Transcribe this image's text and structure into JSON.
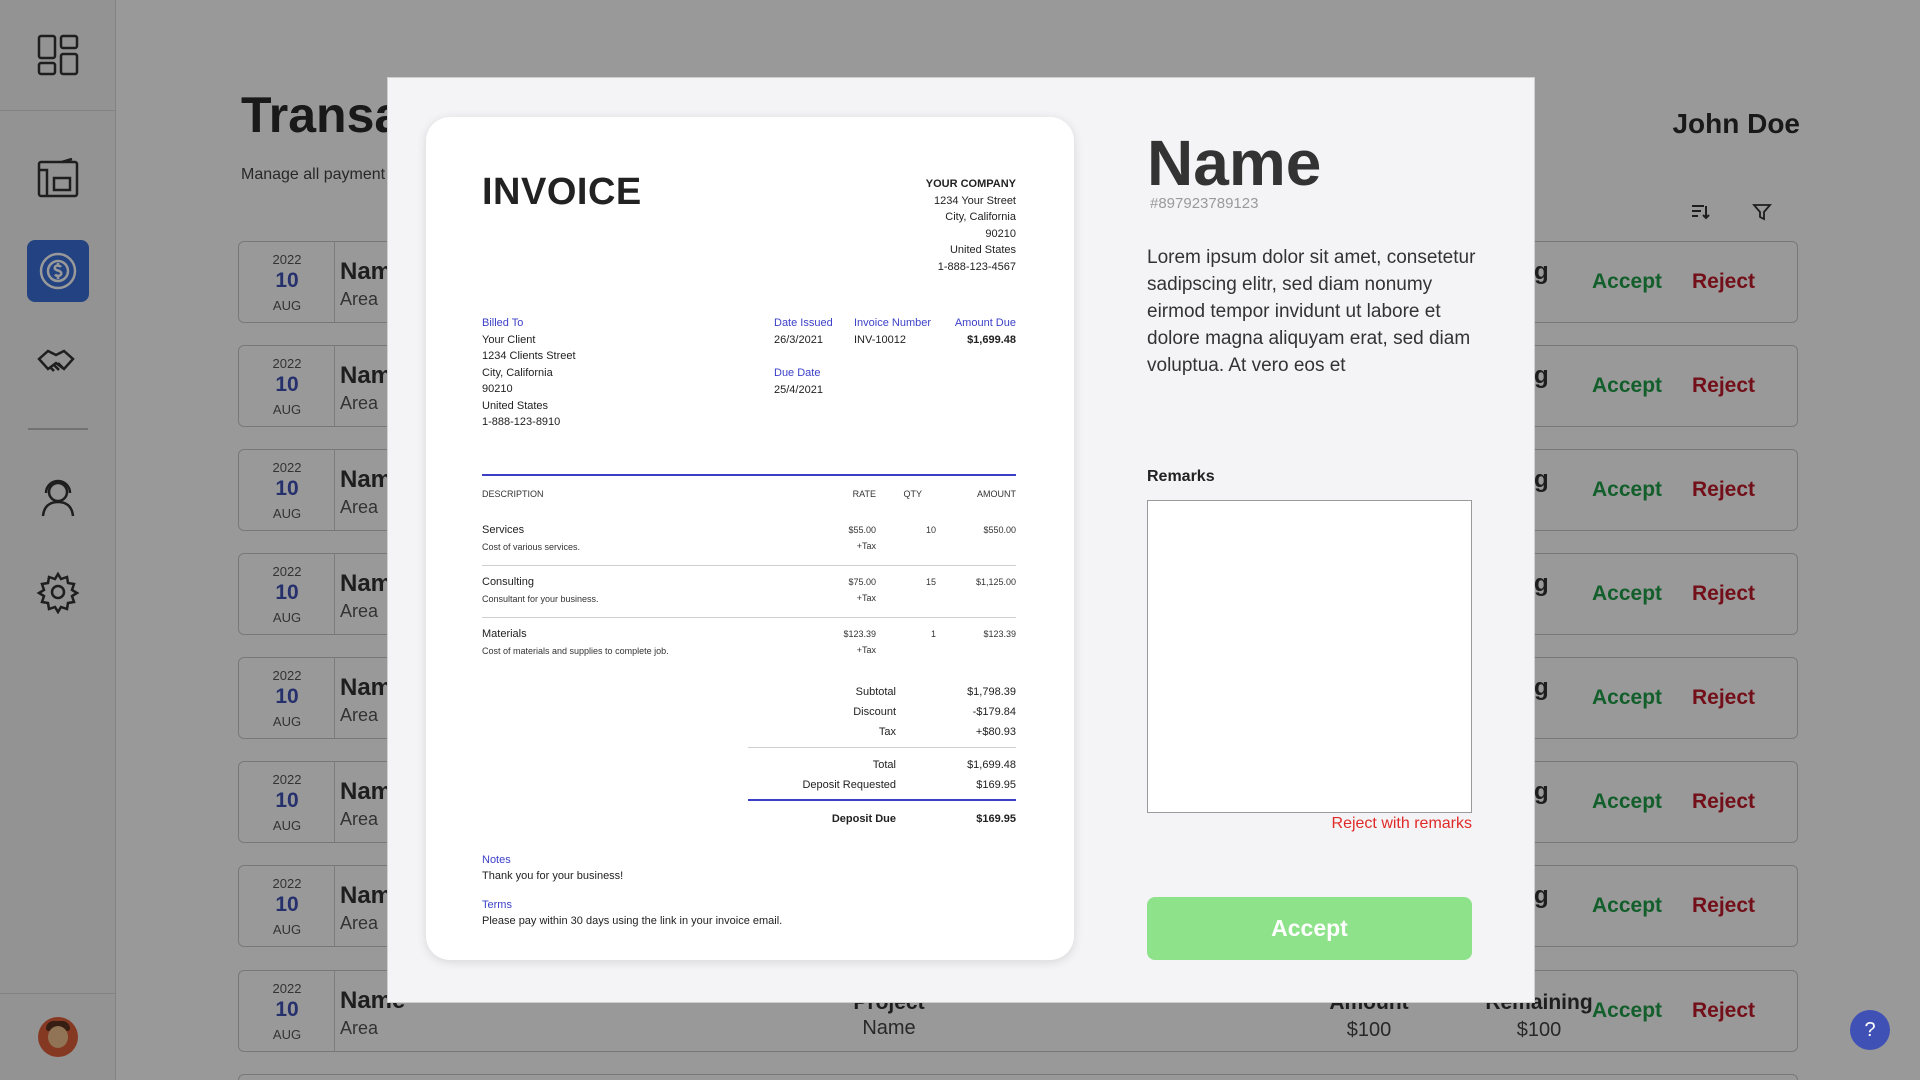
{
  "app": {
    "title": "Transa",
    "subtitle": "Manage all payment",
    "user_name": "John Doe"
  },
  "sidebar": {
    "items": [
      {
        "icon": "dashboard-icon"
      },
      {
        "icon": "blueprint-icon"
      },
      {
        "icon": "payments-icon",
        "active": true
      },
      {
        "icon": "handshake-icon"
      },
      {
        "icon": "support-agent-icon"
      },
      {
        "icon": "gear-icon"
      }
    ]
  },
  "transactions": [
    {
      "year": "2022",
      "day": "10",
      "month": "AUG",
      "name": "Nam",
      "area": "Area",
      "status": "g",
      "accept": "Accept",
      "reject": "Reject"
    },
    {
      "year": "2022",
      "day": "10",
      "month": "AUG",
      "name": "Nam",
      "area": "Area",
      "status": "g",
      "accept": "Accept",
      "reject": "Reject"
    },
    {
      "year": "2022",
      "day": "10",
      "month": "AUG",
      "name": "Nam",
      "area": "Area",
      "status": "g",
      "accept": "Accept",
      "reject": "Reject"
    },
    {
      "year": "2022",
      "day": "10",
      "month": "AUG",
      "name": "Nam",
      "area": "Area",
      "status": "g",
      "accept": "Accept",
      "reject": "Reject"
    },
    {
      "year": "2022",
      "day": "10",
      "month": "AUG",
      "name": "Nam",
      "area": "Area",
      "status": "g",
      "accept": "Accept",
      "reject": "Reject"
    },
    {
      "year": "2022",
      "day": "10",
      "month": "AUG",
      "name": "Nam",
      "area": "Area",
      "status": "g",
      "accept": "Accept",
      "reject": "Reject"
    },
    {
      "year": "2022",
      "day": "10",
      "month": "AUG",
      "name": "Nam",
      "area": "Area",
      "status": "g",
      "accept": "Accept",
      "reject": "Reject"
    },
    {
      "year": "2022",
      "day": "10",
      "month": "AUG",
      "name": "Name",
      "area": "Area",
      "project_label": "Project",
      "project": "Name",
      "amount_label": "Amount",
      "amount": "$100",
      "remaining_label": "Remaining",
      "remaining": "$100",
      "accept": "Accept",
      "reject": "Reject"
    }
  ],
  "help": {
    "label": "?"
  },
  "modal": {
    "name": "Name",
    "id": "#897923789123",
    "description": "Lorem ipsum dolor sit amet, consetetur sadipscing elitr, sed diam nonumy eirmod tempor invidunt ut labore et dolore magna aliquyam erat, sed diam voluptua. At vero eos et",
    "remarks_label": "Remarks",
    "remarks_value": "",
    "reject_link": "Reject with remarks",
    "accept_button": "Accept"
  },
  "invoice": {
    "title": "INVOICE",
    "company": {
      "name": "YOUR COMPANY",
      "street": "1234 Your Street",
      "city": "City, California",
      "zip": "90210",
      "country": "United States",
      "phone": "1-888-123-4567"
    },
    "billed_to": {
      "label": "Billed To",
      "name": "Your Client",
      "street": "1234 Clients Street",
      "city": "City, California",
      "zip": "90210",
      "country": "United States",
      "phone": "1-888-123-8910"
    },
    "date_issued_label": "Date Issued",
    "date_issued": "26/3/2021",
    "invoice_number_label": "Invoice Number",
    "invoice_number": "INV-10012",
    "amount_due_label": "Amount Due",
    "amount_due": "$1,699.48",
    "due_date_label": "Due Date",
    "due_date": "25/4/2021",
    "columns": {
      "description": "DESCRIPTION",
      "rate": "RATE",
      "qty": "QTY",
      "amount": "AMOUNT"
    },
    "items": [
      {
        "name": "Services",
        "desc": "Cost of various services.",
        "rate": "$55.00",
        "tax": "+Tax",
        "qty": "10",
        "amount": "$550.00"
      },
      {
        "name": "Consulting",
        "desc": "Consultant for your business.",
        "rate": "$75.00",
        "tax": "+Tax",
        "qty": "15",
        "amount": "$1,125.00"
      },
      {
        "name": "Materials",
        "desc": "Cost of materials and supplies to complete job.",
        "rate": "$123.39",
        "tax": "+Tax",
        "qty": "1",
        "amount": "$123.39"
      }
    ],
    "totals": {
      "subtotal_label": "Subtotal",
      "subtotal": "$1,798.39",
      "discount_label": "Discount",
      "discount": "-$179.84",
      "tax_label": "Tax",
      "tax": "+$80.93",
      "total_label": "Total",
      "total": "$1,699.48",
      "deposit_requested_label": "Deposit Requested",
      "deposit_requested": "$169.95",
      "deposit_due_label": "Deposit Due",
      "deposit_due": "$169.95"
    },
    "notes_label": "Notes",
    "notes": "Thank you for your business!",
    "terms_label": "Terms",
    "terms": "Please pay within 30 days using the link in your invoice email."
  }
}
